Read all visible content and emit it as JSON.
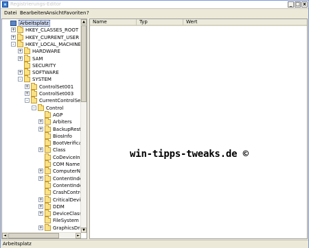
{
  "window": {
    "title": "Registrierungs-Editor",
    "buttons": {
      "minimize": "_",
      "maximize": "□",
      "close": "x"
    }
  },
  "menu": [
    "Datei",
    "Bearbeiten",
    "Ansicht",
    "Favoriten",
    "?"
  ],
  "list": {
    "columns": [
      "Name",
      "Typ",
      "Wert"
    ],
    "watermark": "win-tipps-tweaks.de ©"
  },
  "tree": {
    "nodes": [
      {
        "label": "Arbeitsplatz",
        "icon": "computer-icon",
        "expander": "",
        "selected": true
      },
      {
        "label": "HKEY_CLASSES_ROOT",
        "icon": "folder-icon",
        "expander": "+"
      },
      {
        "label": "HKEY_CURRENT_USER",
        "icon": "folder-icon",
        "expander": "+"
      },
      {
        "label": "HKEY_LOCAL_MACHINE",
        "icon": "folder-icon",
        "expander": "-"
      },
      {
        "label": "HARDWARE",
        "icon": "folder-icon",
        "expander": "+"
      },
      {
        "label": "SAM",
        "icon": "folder-icon",
        "expander": "+"
      },
      {
        "label": "SECURITY",
        "icon": "folder-icon",
        "expander": ""
      },
      {
        "label": "SOFTWARE",
        "icon": "folder-icon",
        "expander": "+"
      },
      {
        "label": "SYSTEM",
        "icon": "folder-icon",
        "expander": "-"
      },
      {
        "label": "ControlSet001",
        "icon": "folder-icon",
        "expander": "+"
      },
      {
        "label": "ControlSet003",
        "icon": "folder-icon",
        "expander": "+"
      },
      {
        "label": "CurrentControlSet",
        "icon": "folder-icon",
        "expander": "-"
      },
      {
        "label": "Control",
        "icon": "folder-icon",
        "expander": "-"
      },
      {
        "label": "AGP",
        "icon": "folder-icon",
        "expander": ""
      },
      {
        "label": "Arbiters",
        "icon": "folder-icon",
        "expander": "+"
      },
      {
        "label": "BackupRestore",
        "icon": "folder-icon",
        "expander": "+"
      },
      {
        "label": "BiosInfo",
        "icon": "folder-icon",
        "expander": ""
      },
      {
        "label": "BootVerificationProgram",
        "icon": "folder-icon",
        "expander": ""
      },
      {
        "label": "Class",
        "icon": "folder-icon",
        "expander": "+"
      },
      {
        "label": "CoDeviceInstallers",
        "icon": "folder-icon",
        "expander": ""
      },
      {
        "label": "COM Name Arbiter",
        "icon": "folder-icon",
        "expander": ""
      },
      {
        "label": "ComputerName",
        "icon": "folder-icon",
        "expander": "+"
      },
      {
        "label": "ContentIndex",
        "icon": "folder-icon",
        "expander": "+"
      },
      {
        "label": "ContentIndexCommon",
        "icon": "folder-icon",
        "expander": ""
      },
      {
        "label": "CrashControl",
        "icon": "folder-icon",
        "expander": ""
      },
      {
        "label": "CriticalDeviceDatabase",
        "icon": "folder-icon",
        "expander": "+"
      },
      {
        "label": "DDM",
        "icon": "folder-icon",
        "expander": "+"
      },
      {
        "label": "DeviceClasses",
        "icon": "folder-icon",
        "expander": "+"
      },
      {
        "label": "FileSystem",
        "icon": "folder-icon",
        "expander": ""
      },
      {
        "label": "GraphicsDrivers",
        "icon": "folder-icon",
        "expander": "+"
      }
    ]
  },
  "status": {
    "text": "Arbeitsplatz"
  }
}
